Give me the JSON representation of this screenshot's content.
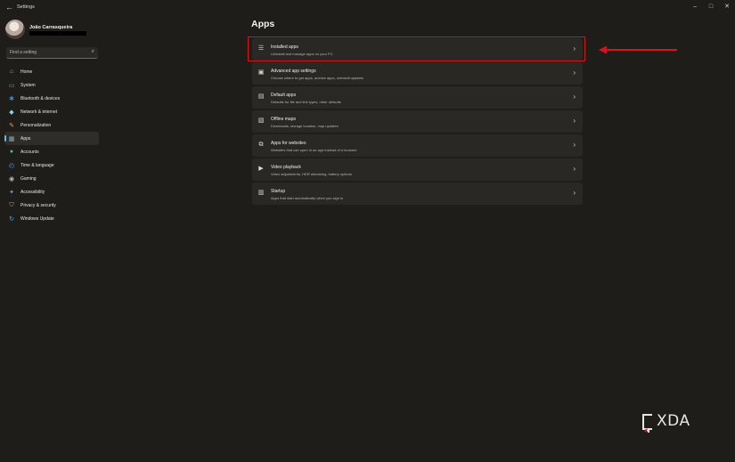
{
  "window": {
    "title": "Settings",
    "controls": [
      "minimize",
      "maximize",
      "close"
    ]
  },
  "profile": {
    "name": "João Carrasqueira",
    "email": ""
  },
  "search": {
    "placeholder": "Find a setting"
  },
  "sidebar": {
    "items": [
      {
        "label": "Home",
        "icon": "home-icon",
        "color": "#f0a36b",
        "active": false
      },
      {
        "label": "System",
        "icon": "system-icon",
        "color": "#4aa7e8",
        "active": false
      },
      {
        "label": "Bluetooth & devices",
        "icon": "bluetooth-icon",
        "color": "#2f8ee0",
        "active": false
      },
      {
        "label": "Network & internet",
        "icon": "network-icon",
        "color": "#8fd0f5",
        "active": false
      },
      {
        "label": "Personalization",
        "icon": "personalization-icon",
        "color": "#f09c4e",
        "active": false
      },
      {
        "label": "Apps",
        "icon": "apps-icon",
        "color": "#9aa4b0",
        "active": true
      },
      {
        "label": "Accounts",
        "icon": "accounts-icon",
        "color": "#3fc2a0",
        "active": false
      },
      {
        "label": "Time & language",
        "icon": "time-language-icon",
        "color": "#4aa7e8",
        "active": false
      },
      {
        "label": "Gaming",
        "icon": "gaming-icon",
        "color": "#b8b8b8",
        "active": false
      },
      {
        "label": "Accessibility",
        "icon": "accessibility-icon",
        "color": "#4aa7e8",
        "active": false
      },
      {
        "label": "Privacy & security",
        "icon": "privacy-security-icon",
        "color": "#9aa4b0",
        "active": false
      },
      {
        "label": "Windows Update",
        "icon": "windows-update-icon",
        "color": "#4aa7e8",
        "active": false
      }
    ]
  },
  "main": {
    "title": "Apps",
    "items": [
      {
        "title": "Installed apps",
        "subtitle": "Uninstall and manage apps on your PC",
        "icon": "installed-apps-icon"
      },
      {
        "title": "Advanced app settings",
        "subtitle": "Choose where to get apps, archive apps, uninstall updates",
        "icon": "advanced-app-settings-icon"
      },
      {
        "title": "Default apps",
        "subtitle": "Defaults for file and link types, other defaults",
        "icon": "default-apps-icon"
      },
      {
        "title": "Offline maps",
        "subtitle": "Downloads, storage location, map updates",
        "icon": "offline-maps-icon"
      },
      {
        "title": "Apps for websites",
        "subtitle": "Websites that can open in an app instead of a browser",
        "icon": "apps-for-websites-icon"
      },
      {
        "title": "Video playback",
        "subtitle": "Video adjustments, HDR streaming, battery options",
        "icon": "video-playback-icon"
      },
      {
        "title": "Startup",
        "subtitle": "Apps that start automatically when you sign in",
        "icon": "startup-icon"
      }
    ]
  },
  "annotation": {
    "color": "#d6141b"
  },
  "watermark": {
    "text": "XDA"
  }
}
